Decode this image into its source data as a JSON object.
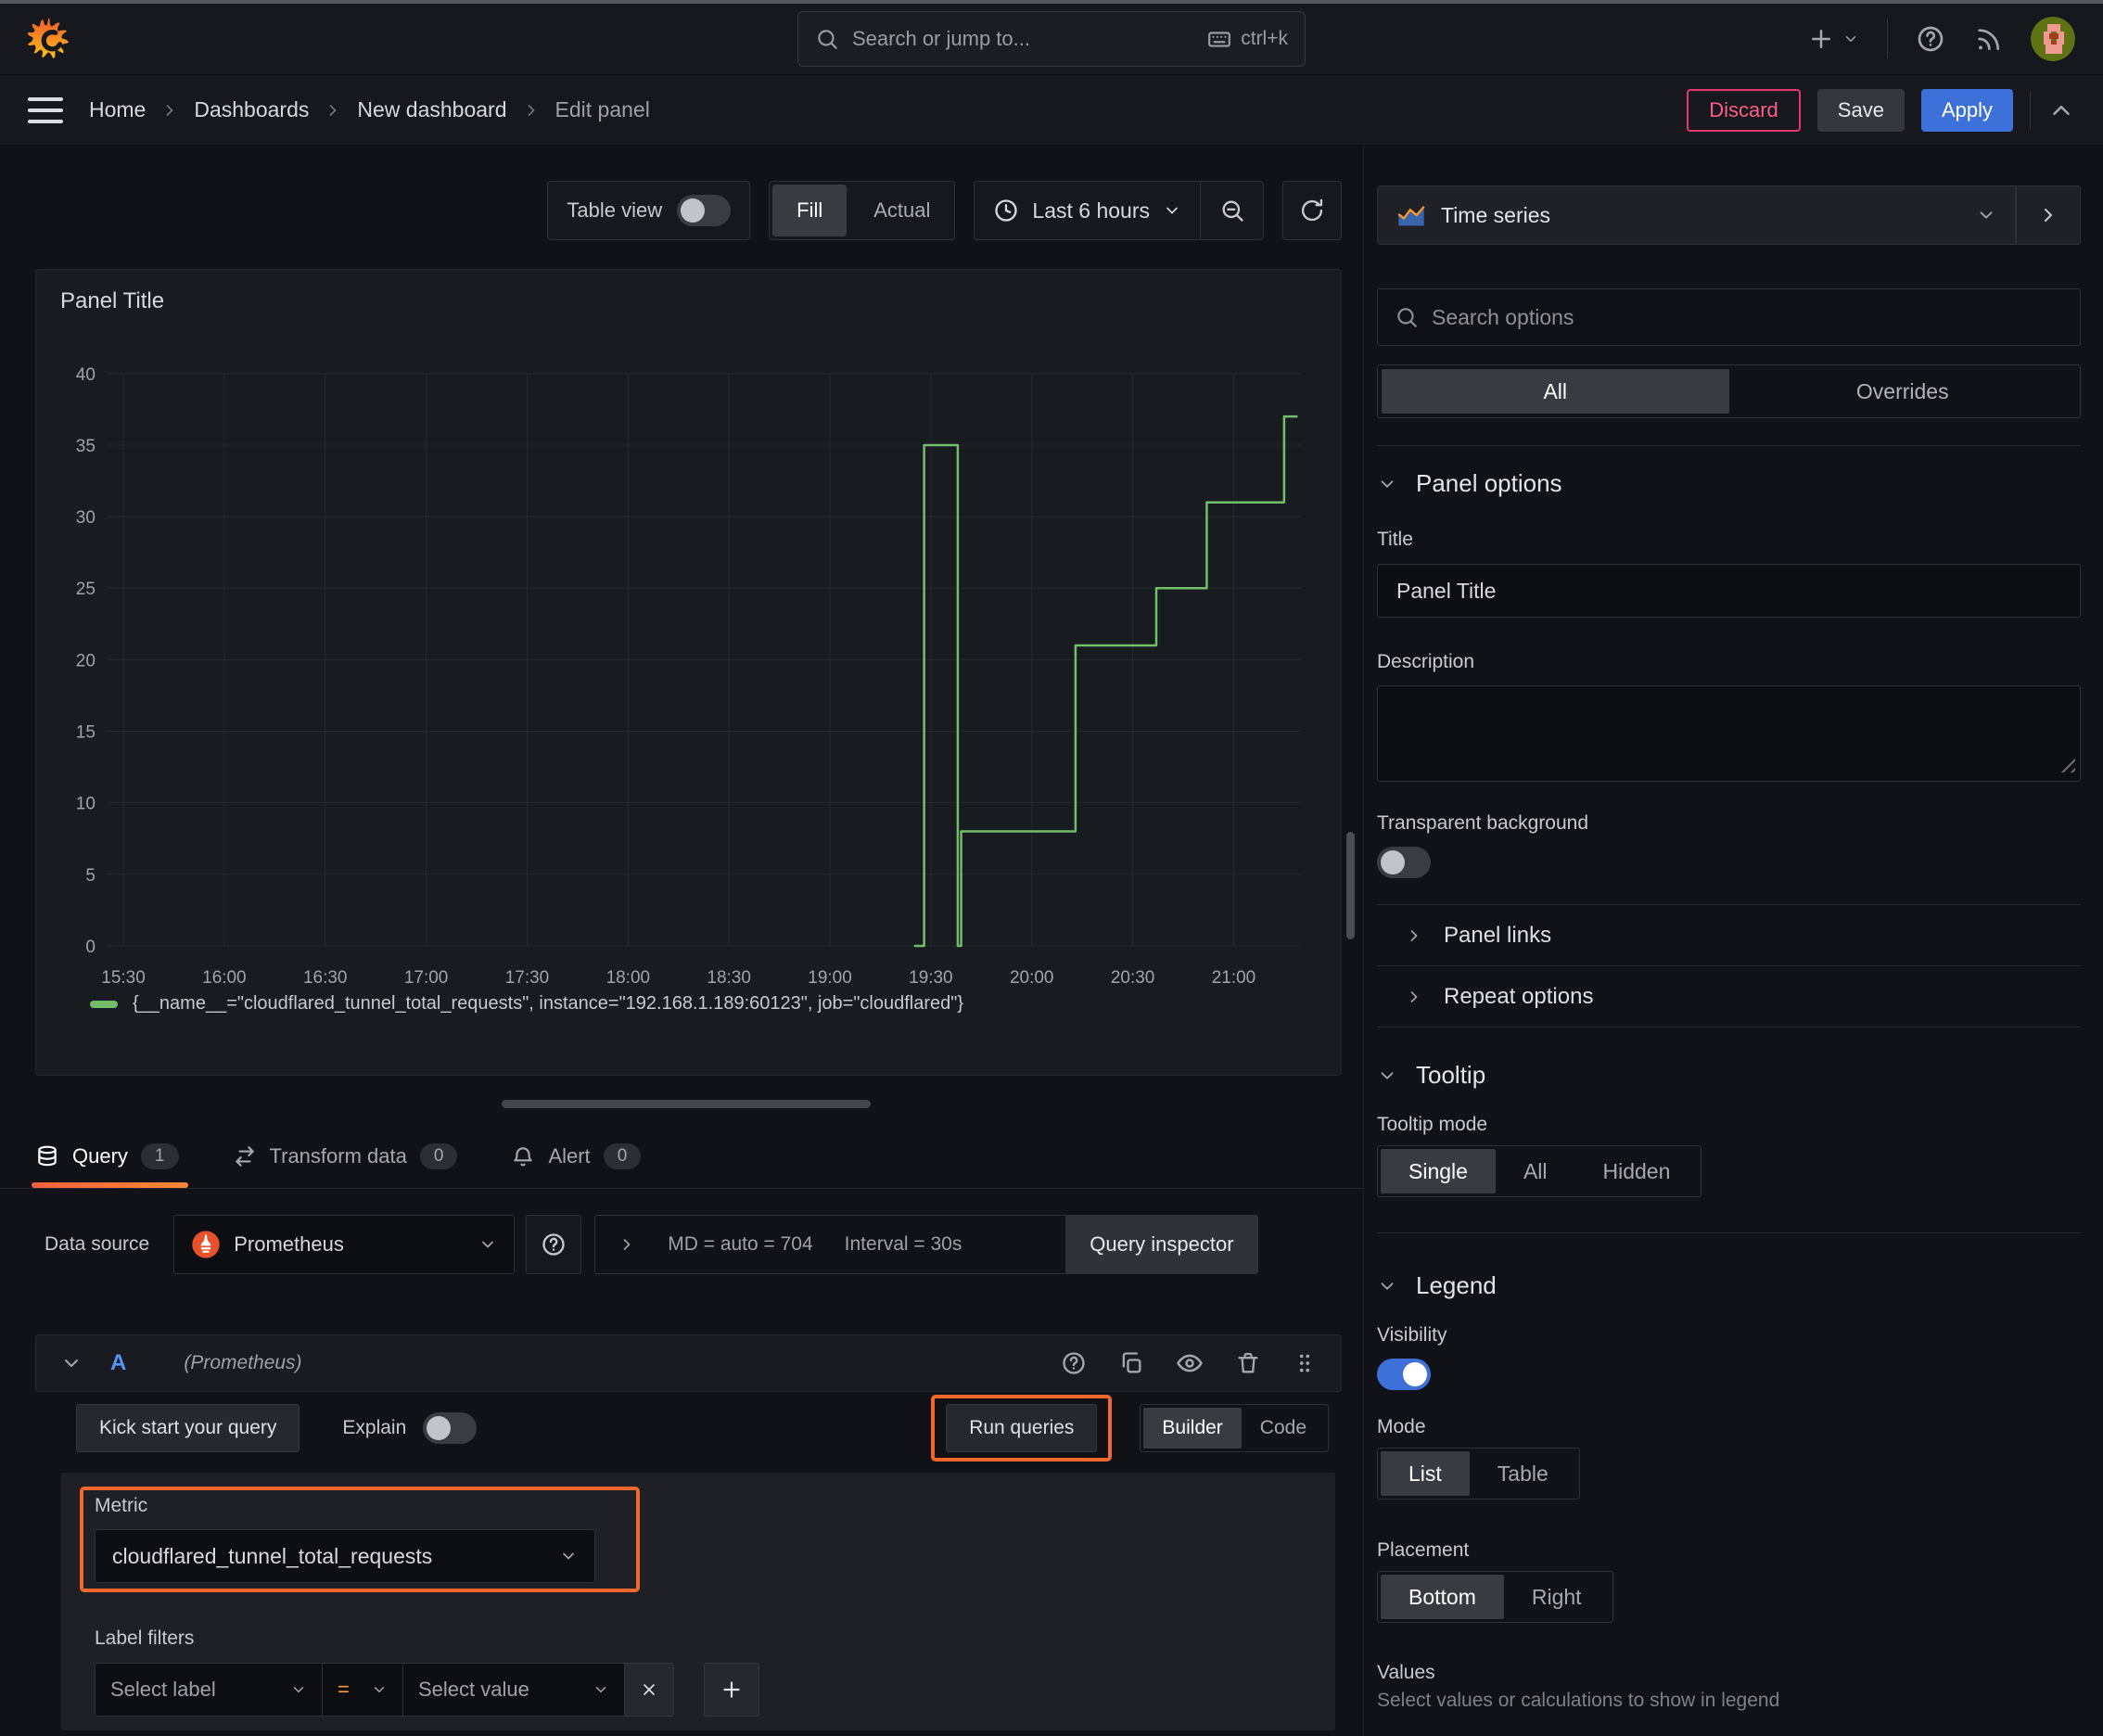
{
  "colors": {
    "accent_blue": "#3D71D9",
    "series_green": "#73BF69",
    "danger_pink": "#E5366E",
    "annotation_orange": "#F2672C",
    "tab_underline": [
      "#F55F3E",
      "#FF8833"
    ],
    "prometheus_orange": "#E6522C",
    "background": "#111217",
    "panel_background": "#181B20"
  },
  "topbar": {
    "search_placeholder": "Search or jump to...",
    "search_shortcut": "ctrl+k"
  },
  "breadcrumb": {
    "items": [
      "Home",
      "Dashboards",
      "New dashboard",
      "Edit panel"
    ],
    "discard": "Discard",
    "save": "Save",
    "apply": "Apply"
  },
  "toolbar": {
    "table_view": "Table view",
    "fill": "Fill",
    "actual": "Actual",
    "time_range": "Last 6 hours"
  },
  "panel": {
    "title": "Panel Title",
    "legend_series": "{__name__=\"cloudflared_tunnel_total_requests\", instance=\"192.168.1.189:60123\", job=\"cloudflared\"}"
  },
  "chart_data": {
    "type": "line",
    "title": "Panel Title",
    "xlabel": "",
    "ylabel": "",
    "x_domain": [
      "15:25",
      "21:20"
    ],
    "ylim": [
      0,
      40
    ],
    "x_ticks": [
      "15:30",
      "16:00",
      "16:30",
      "17:00",
      "17:30",
      "18:00",
      "18:30",
      "19:00",
      "19:30",
      "20:00",
      "20:30",
      "21:00"
    ],
    "y_ticks": [
      0,
      5,
      10,
      15,
      20,
      25,
      30,
      35,
      40
    ],
    "grid": true,
    "legend_position": "bottom",
    "series": [
      {
        "name": "{__name__=\"cloudflared_tunnel_total_requests\", instance=\"192.168.1.189:60123\", job=\"cloudflared\"}",
        "color": "#73BF69",
        "interpolation": "step-after",
        "points": [
          [
            "19:25",
            0
          ],
          [
            "19:28",
            35
          ],
          [
            "19:38",
            0
          ],
          [
            "19:39",
            8
          ],
          [
            "20:13",
            21
          ],
          [
            "20:37",
            25
          ],
          [
            "20:52",
            31
          ],
          [
            "21:15",
            37
          ],
          [
            "21:19",
            37
          ]
        ]
      }
    ]
  },
  "tabs": {
    "query": "Query",
    "query_count": "1",
    "transform": "Transform data",
    "transform_count": "0",
    "alert": "Alert",
    "alert_count": "0"
  },
  "datasource": {
    "label": "Data source",
    "name": "Prometheus",
    "stats_md": "MD = auto = 704",
    "stats_interval": "Interval = 30s",
    "query_inspector": "Query inspector"
  },
  "query": {
    "ref_id": "A",
    "ds_hint": "(Prometheus)",
    "kick_start": "Kick start your query",
    "explain": "Explain",
    "run_queries": "Run queries",
    "builder": "Builder",
    "code": "Code",
    "metric_label": "Metric",
    "metric_value": "cloudflared_tunnel_total_requests",
    "label_filters": "Label filters",
    "select_label": "Select label",
    "operator": "=",
    "select_value": "Select value"
  },
  "sidebar": {
    "viz_name": "Time series",
    "search_placeholder": "Search options",
    "tab_all": "All",
    "tab_overrides": "Overrides",
    "panel_options": {
      "heading": "Panel options",
      "title_label": "Title",
      "title_value": "Panel Title",
      "description_label": "Description",
      "transparent_label": "Transparent background"
    },
    "panel_links": "Panel links",
    "repeat_options": "Repeat options",
    "tooltip": {
      "heading": "Tooltip",
      "mode_label": "Tooltip mode",
      "options": [
        "Single",
        "All",
        "Hidden"
      ]
    },
    "legend": {
      "heading": "Legend",
      "visibility_label": "Visibility",
      "mode_label": "Mode",
      "mode_options": [
        "List",
        "Table"
      ],
      "placement_label": "Placement",
      "placement_options": [
        "Bottom",
        "Right"
      ],
      "values_label": "Values",
      "values_hint": "Select values or calculations to show in legend"
    }
  }
}
